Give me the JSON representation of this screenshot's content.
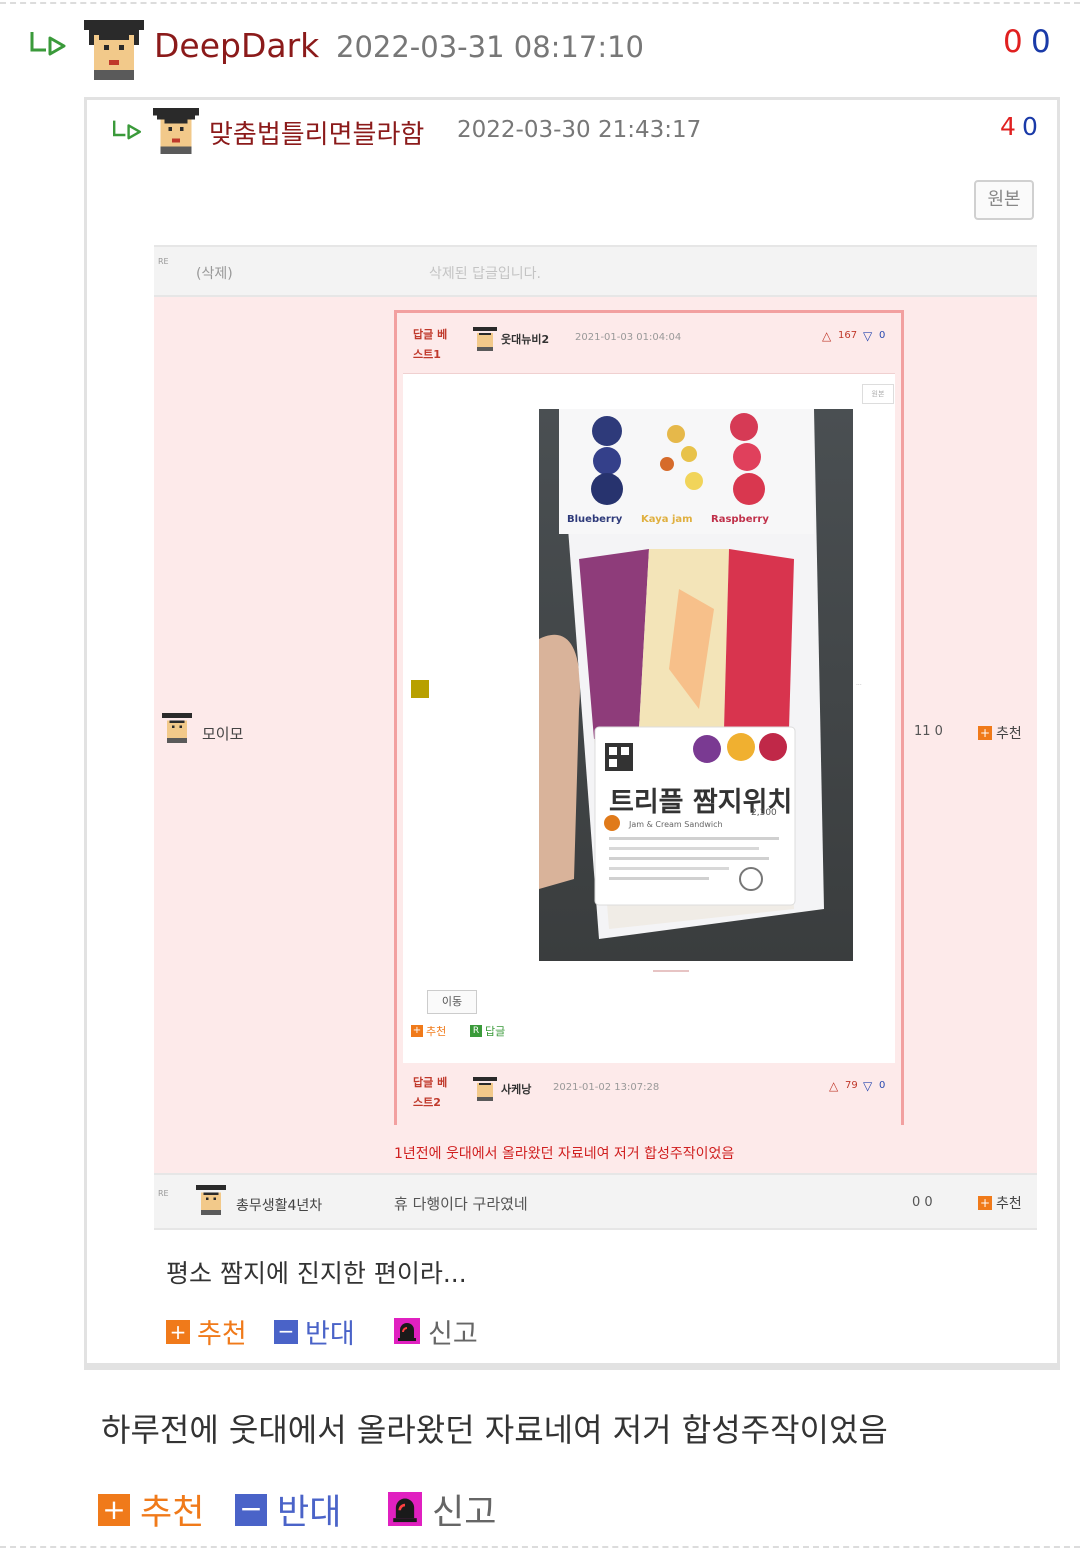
{
  "comment": {
    "username": "DeepDark",
    "timestamp": "2022-03-31 08:17:10",
    "votes_up": "0",
    "votes_down": "0",
    "body": "하루전에 웃대에서 올라왔던 자료네여 저거 합성주작이었음",
    "actions": {
      "recommend": "추천",
      "oppose": "반대",
      "report": "신고"
    }
  },
  "quoted": {
    "username": "맞춤법틀리면블라함",
    "timestamp": "2022-03-30 21:43:17",
    "votes_up": "4",
    "votes_down": "0",
    "original_button": "원본",
    "body": "평소 짬지에 진지한 편이라...",
    "actions": {
      "recommend": "추천",
      "oppose": "반대",
      "report": "신고"
    }
  },
  "screenshot": {
    "deleted_row": {
      "re": "RE",
      "author": "(삭제)",
      "text": "삭제된 답글입니다."
    },
    "main_row": {
      "author": "모이모",
      "votes": "11  0",
      "recommend": "추천"
    },
    "best1": {
      "badge": "답글 베스트1",
      "author": "웃대뉴비2",
      "timestamp": "2021-01-03 01:04:04",
      "likes": "167",
      "dislikes": "0",
      "original_button": "원본",
      "move_button": "이동",
      "recommend": "추천",
      "reply": "답글"
    },
    "photo": {
      "flavors": [
        "Blueberry",
        "Kaya jam",
        "Raspberry"
      ],
      "product": "트리플 짬지위치",
      "sub": "Jam & Cream Sandwich",
      "price": "2,300"
    },
    "best2": {
      "badge": "답글 베스트2",
      "author": "사케낭",
      "timestamp": "2021-01-02 13:07:28",
      "likes": "79",
      "dislikes": "0"
    },
    "note": "1년전에 웃대에서 올라왔던 자료네여 저거 합성주작이었음",
    "bottom_row": {
      "re": "RE",
      "author": "총무생활4년차",
      "text": "휴 다행이다 구라였네",
      "votes": "0  0",
      "recommend": "추천"
    }
  },
  "colors": {
    "username": "#8b1a1a",
    "vote_up": "#e02020",
    "vote_down": "#1a3aa8",
    "recommend": "#f07a1a",
    "oppose": "#4a63c8",
    "report": "#e020c0",
    "pink_bg": "#fdeaea",
    "reply_arrow": "#3a9a3a"
  }
}
